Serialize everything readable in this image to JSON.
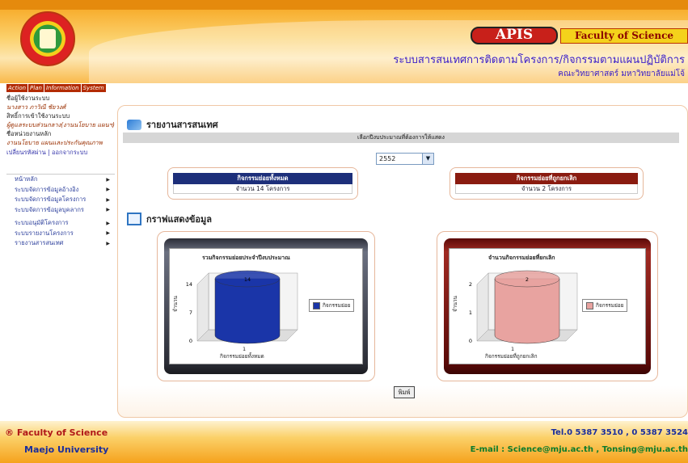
{
  "header": {
    "badge": "APIS",
    "faculty_badge": "Faculty of Science",
    "system_title": "ระบบสารสนเทศการติดตามโครงการ/กิจกรรมตามแผนปฏิบัติการ",
    "system_sub": "คณะวิทยาศาสตร์ มหาวิทยาลัยแม่โจ้"
  },
  "sidebar": {
    "menu_strip": [
      "Action",
      "Plan",
      "Information",
      "System"
    ],
    "info": [
      {
        "label": "ชื่อผู้ใช้งานระบบ",
        "value": "นางสาว ภาวิณี ชัยวงศ์"
      },
      {
        "label": "สิทธิ์การเข้าใช้งานระบบ",
        "value": "ผู้ดูแลระบบส่วนกลาง(งานนโยบาย แผนฯ)"
      },
      {
        "label": "ชื่อหน่วยงานหลัก",
        "value": "งานนโยบาย แผนและประกันคุณภาพ"
      }
    ],
    "account_links": "เปลี่ยนรหัสผ่าน | ออกจากระบบ",
    "nav": [
      "หน้าหลัก",
      "ระบบจัดการข้อมูลอ้างอิง",
      "ระบบจัดการข้อมูลโครงการ",
      "ระบบจัดการข้อมูลบุคลากร",
      "ระบบอนุมัติโครงการ",
      "ระบบรายงานโครงการ",
      "รายงานสารสนเทศ"
    ]
  },
  "main": {
    "section_title": "รายงานสารสนเทศ",
    "year_prompt": "เลือกปีงบประมาณที่ต้องการให้แสดง",
    "year_value": "2552",
    "box_all": {
      "title": "กิจกรรมย่อยทั้งหมด",
      "value": "จำนวน 14 โครงการ"
    },
    "box_cancel": {
      "title": "กิจกรรมย่อยที่ถูกยกเลิก",
      "value": "จำนวน 2 โครงการ"
    },
    "graph_title": "กราฟแสดงข้อมูล",
    "print_label": "พิมพ์"
  },
  "chart_data": [
    {
      "type": "bar",
      "title": "รวมกิจกรรมย่อยประจำปีงบประมาณ",
      "ylabel": "จำนวน",
      "categories": [
        "1"
      ],
      "xlabel": "กิจกรรมย่อยทั้งหมด",
      "yticks": [
        "0",
        "7",
        "14"
      ],
      "series": [
        {
          "name": "กิจกรรมย่อย",
          "values": [
            14
          ]
        }
      ],
      "data_label": "14",
      "ylim": [
        0,
        14
      ],
      "color": "#1a35a8"
    },
    {
      "type": "bar",
      "title": "จำนวนกิจกรรมย่อยที่ยกเลิก",
      "ylabel": "จำนวน",
      "categories": [
        "1"
      ],
      "xlabel": "กิจกรรมย่อยที่ถูกยกเลิก",
      "yticks": [
        "0",
        "1",
        "2"
      ],
      "series": [
        {
          "name": "กิจกรรมย่อย",
          "values": [
            2
          ]
        }
      ],
      "data_label": "2",
      "ylim": [
        0,
        2
      ],
      "color": "#e8a3a0"
    }
  ],
  "footer": {
    "left1": "® Faculty of Science",
    "left2": "Maejo University",
    "right1": "Tel.0 5387 3510 , 0 5387 3524",
    "right2": "E-mail : Science@mju.ac.th , Tonsing@mju.ac.th"
  }
}
